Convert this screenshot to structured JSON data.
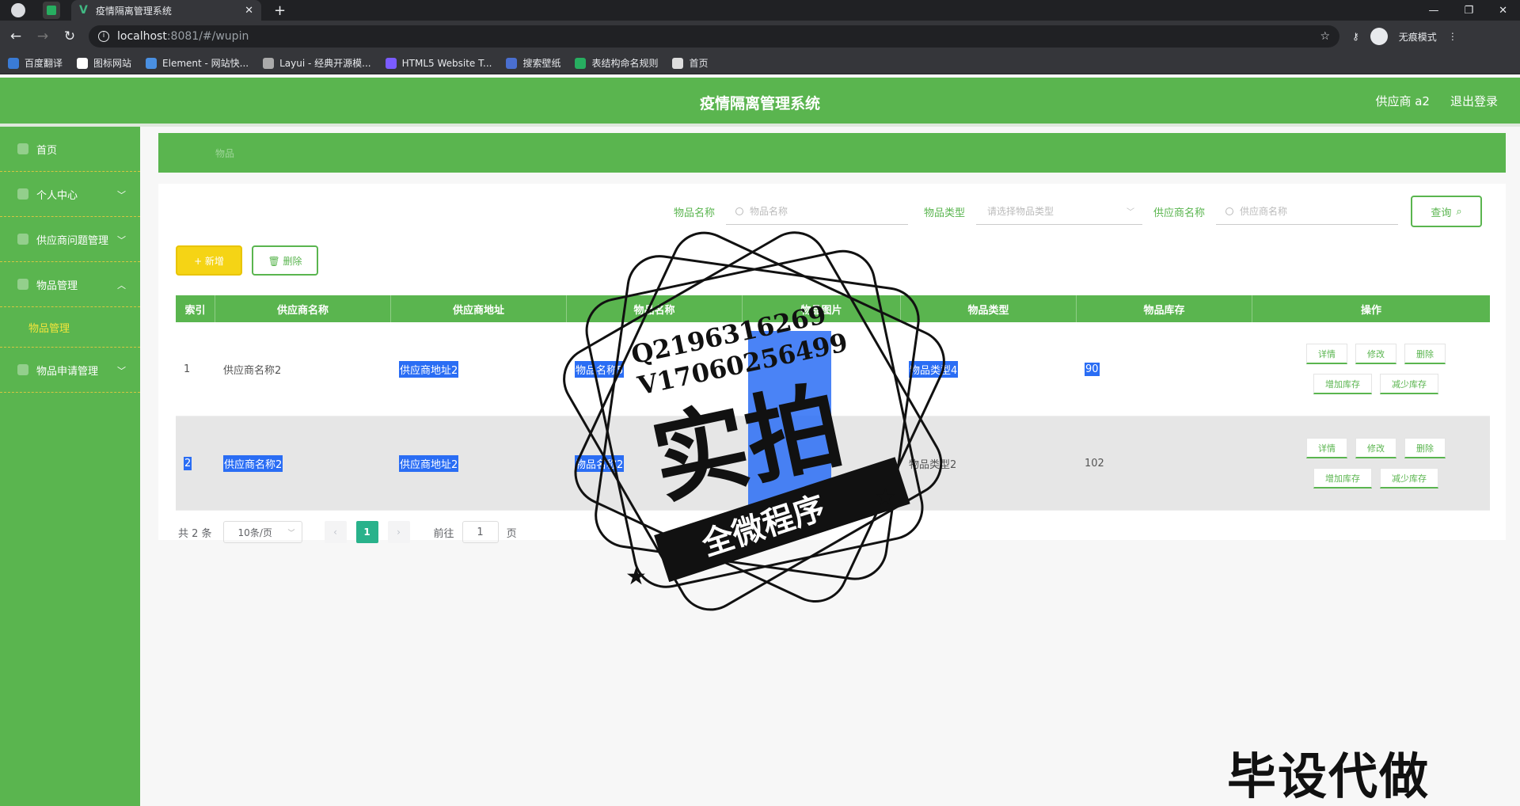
{
  "browser": {
    "tab_title": "疫情隔离管理系统",
    "tab_close": "✕",
    "new_tab": "+",
    "url_host": "localhost",
    "url_path": ":8081/#/wupin",
    "incognito_label": "无痕模式",
    "window_controls": [
      "—",
      "❐",
      "✕"
    ],
    "bookmarks": [
      {
        "label": "百度翻译",
        "color": "#3a7bd5"
      },
      {
        "label": "图标网站",
        "color": "#ffffff"
      },
      {
        "label": "Element - 网站快...",
        "color": "#4a90e2"
      },
      {
        "label": "Layui - 经典开源模...",
        "color": "#aaaaaa"
      },
      {
        "label": "HTML5 Website T...",
        "color": "#7b5cff"
      },
      {
        "label": "搜索壁纸",
        "color": "#4a6fd0"
      },
      {
        "label": "表结构命名规则",
        "color": "#27ae60"
      },
      {
        "label": "首页",
        "color": "#dddddd"
      }
    ]
  },
  "header": {
    "title": "疫情隔离管理系统",
    "user": "供应商 a2",
    "logout": "退出登录"
  },
  "sidebar": {
    "items": [
      {
        "label": "首页",
        "arrow": ""
      },
      {
        "label": "个人中心",
        "arrow": "﹀"
      },
      {
        "label": "供应商问题管理",
        "arrow": "﹀"
      },
      {
        "label": "物品管理",
        "arrow": "︿"
      },
      {
        "label": "物品申请管理",
        "arrow": "﹀"
      }
    ],
    "active_sub": "物品管理"
  },
  "breadcrumb": "物品",
  "search": {
    "name_label": "物品名称",
    "name_placeholder": "物品名称",
    "type_label": "物品类型",
    "type_placeholder": "请选择物品类型",
    "supplier_label": "供应商名称",
    "supplier_placeholder": "供应商名称",
    "query_label": "查询"
  },
  "actions": {
    "add": "+ 新增",
    "delete": "🗑 删除"
  },
  "table": {
    "headers": [
      "索引",
      "供应商名称",
      "供应商地址",
      "物品名称",
      "物品图片",
      "物品类型",
      "物品库存",
      "操作"
    ],
    "rows": [
      {
        "index": "1",
        "supplier": "供应商名称2",
        "address": "供应商地址2",
        "name": "物品名称5",
        "type": "物品类型4",
        "stock": "90"
      },
      {
        "index": "2",
        "supplier": "供应商名称2",
        "address": "供应商地址2",
        "name": "物品名称2",
        "type": "物品类型2",
        "stock": "102"
      }
    ],
    "ops": {
      "detail": "详情",
      "edit": "修改",
      "remove": "删除",
      "add_stock": "增加库存",
      "reduce_stock": "减少库存"
    }
  },
  "pagination": {
    "total": "共 2 条",
    "page_size": "10条/页",
    "current": "1",
    "goto_label": "前往",
    "goto_value": "1",
    "page_unit": "页"
  },
  "stamp": {
    "contact1": "Q2196316269",
    "contact2": "V17060256499",
    "big": "实拍",
    "banner": "全微程序"
  },
  "watermark": "毕设代做"
}
